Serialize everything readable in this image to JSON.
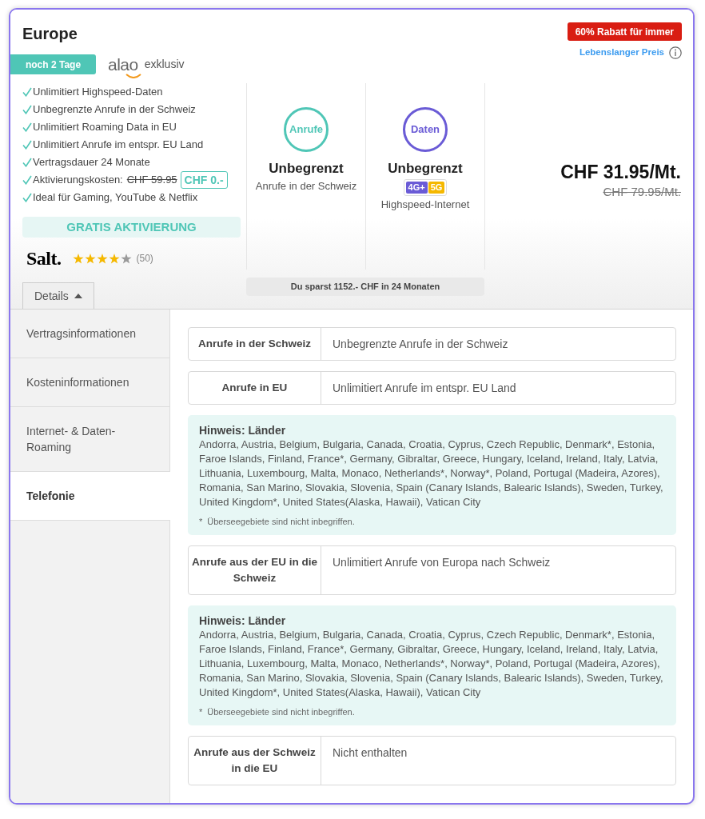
{
  "header": {
    "title": "Europe",
    "discount_badge": "60% Rabatt für immer",
    "price_link": "Lebenslanger Preis",
    "countdown_badge": "noch 2 Tage",
    "partner_logo": "alao",
    "partner_label": "exklusiv"
  },
  "features": [
    {
      "kind": "plain",
      "text": "Unlimitiert Highspeed-Daten"
    },
    {
      "kind": "plain",
      "text": "Unbegrenzte Anrufe in der Schweiz"
    },
    {
      "kind": "plain",
      "text": "Unlimitiert Roaming Data in EU"
    },
    {
      "kind": "plain",
      "text": "Unlimitiert Anrufe im entspr. EU Land"
    },
    {
      "kind": "plain",
      "text": "Vertragsdauer 24 Monate"
    },
    {
      "kind": "price",
      "text": "Aktivierungskosten:",
      "old_price": "CHF 59.95",
      "new_price": "CHF 0.-"
    },
    {
      "kind": "plain",
      "text": "Ideal für Gaming, YouTube & Netflix"
    }
  ],
  "promo_banner": "GRATIS AKTIVIERUNG",
  "provider": {
    "logo": "Salt.",
    "stars": 4,
    "reviews": "(50)"
  },
  "highlights": [
    {
      "icon_label": "Anrufe",
      "color": "#4fc6b6",
      "value": "Unbegrenzt",
      "caption": "Anrufe in der Schweiz"
    },
    {
      "icon_label": "Daten",
      "color": "#6a5bd6",
      "value": "Unbegrenzt",
      "network_badges": [
        {
          "label": "4G+",
          "color": "#6a5bd6"
        },
        {
          "label": "5G",
          "color": "#f5b800"
        }
      ],
      "caption": "Highspeed-Internet"
    }
  ],
  "price": {
    "current": "CHF 31.95/Mt.",
    "previous": "CHF 79.95/Mt."
  },
  "savings": "Du sparst 1152.- CHF in 24 Monaten",
  "details_toggle": {
    "label": "Details",
    "expanded": true
  },
  "sidebar": {
    "items": [
      {
        "label": "Vertragsinformationen",
        "selected": false
      },
      {
        "label": "Kosteninformationen",
        "selected": false
      },
      {
        "label": "Internet- & Daten-Roaming",
        "selected": false
      },
      {
        "label": "Telefonie",
        "selected": true
      }
    ]
  },
  "content": [
    {
      "kind": "row",
      "label": "Anrufe in der Schweiz",
      "value": "Unbegrenzte Anrufe in der Schweiz"
    },
    {
      "kind": "row",
      "label": "Anrufe in EU",
      "value": "Unlimitiert Anrufe im entspr. EU Land"
    },
    {
      "kind": "note",
      "title": "Hinweis: Länder",
      "text": "Andorra, Austria, Belgium, Bulgaria, Canada, Croatia, Cyprus, Czech Republic, Denmark*, Estonia, Faroe Islands, Finland, France*, Germany, Gibraltar, Greece, Hungary, Iceland, Ireland, Italy, Latvia, Lithuania, Luxembourg, Malta, Monaco, Netherlands*, Norway*, Poland, Portugal (Madeira, Azores), Romania, San Marino, Slovakia, Slovenia, Spain (Canary Islands, Balearic Islands), Sweden, Turkey, United Kingdom*, United States(Alaska, Hawaii), Vatican City",
      "footnote_mark": "*",
      "footnote": "Überseegebiete sind nicht inbegriffen."
    },
    {
      "kind": "row",
      "label": "Anrufe aus der EU in die Schweiz",
      "value": "Unlimitiert Anrufe von Europa nach Schweiz"
    },
    {
      "kind": "note",
      "title": "Hinweis: Länder",
      "text": "Andorra, Austria, Belgium, Bulgaria, Canada, Croatia, Cyprus, Czech Republic, Denmark*, Estonia, Faroe Islands, Finland, France*, Germany, Gibraltar, Greece, Hungary, Iceland, Ireland, Italy, Latvia, Lithuania, Luxembourg, Malta, Monaco, Netherlands*, Norway*, Poland, Portugal (Madeira, Azores), Romania, San Marino, Slovakia, Slovenia, Spain (Canary Islands, Balearic Islands), Sweden, Turkey, United Kingdom*, United States(Alaska, Hawaii), Vatican City",
      "footnote_mark": "*",
      "footnote": "Überseegebiete sind nicht inbegriffen."
    },
    {
      "kind": "row",
      "label": "Anrufe aus der Schweiz in die EU",
      "value": "Nicht enthalten"
    }
  ]
}
